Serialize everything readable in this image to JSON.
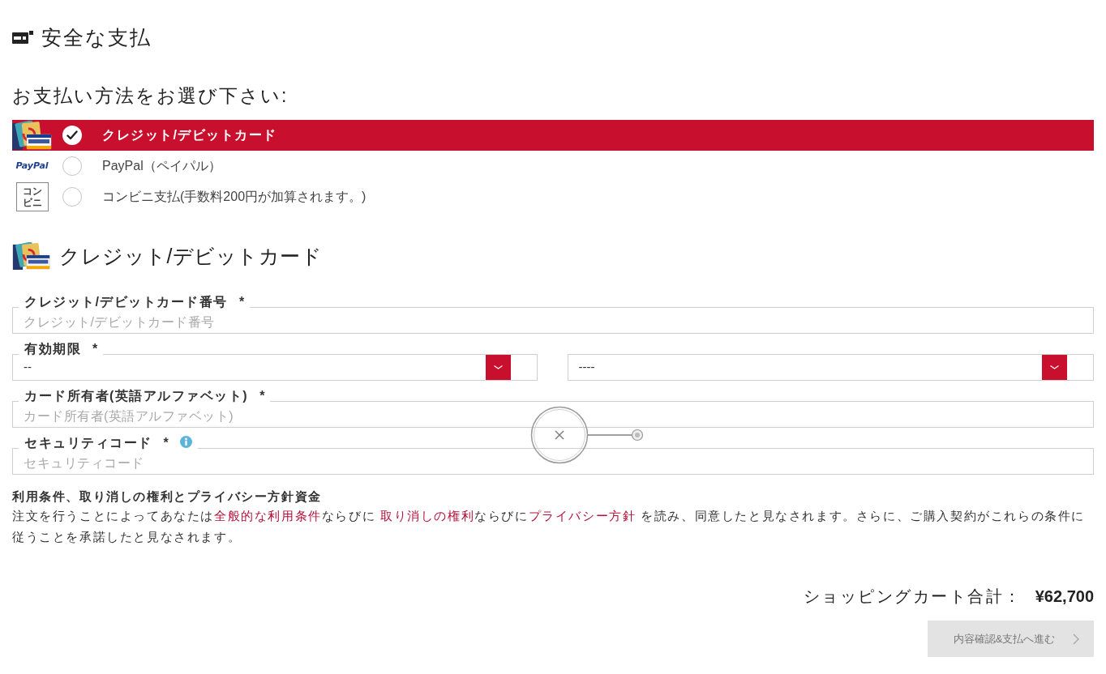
{
  "header": {
    "title": "安全な支払"
  },
  "payment": {
    "prompt": "お支払い方法をお選び下さい:",
    "methods": [
      {
        "kind": "card",
        "label": "クレジット/デビットカード",
        "selected": true
      },
      {
        "kind": "paypal",
        "logo_text": "PayPal",
        "label": "PayPal（ペイパル）",
        "selected": false
      },
      {
        "kind": "konbini",
        "logo_lines": [
          "コン",
          "ビニ"
        ],
        "label": "コンビニ支払(手数料200円が加算されます。)",
        "selected": false
      }
    ]
  },
  "card_form": {
    "title": "クレジット/デビットカード",
    "fields": [
      {
        "kind": "text",
        "label": "クレジット/デビットカード番号",
        "required_mark": "*",
        "info": false,
        "placeholder": "クレジット/デビットカード番号"
      },
      {
        "kind": "expiry",
        "label": "有効期限",
        "required_mark": "*",
        "info": false,
        "selects": [
          {
            "value": "--"
          },
          {
            "value": "----"
          }
        ]
      },
      {
        "kind": "text",
        "label": "カード所有者(英語アルファベット)",
        "required_mark": "*",
        "info": false,
        "placeholder": "カード所有者(英語アルファベット)"
      },
      {
        "kind": "text",
        "label": "セキュリティコード",
        "required_mark": "*",
        "info": true,
        "placeholder": "セキュリティコード"
      }
    ]
  },
  "terms": {
    "title": "利用条件、取り消しの権利とプライバシー方針資金",
    "segments": [
      {
        "kind": "text",
        "text": "注文を行うことによってあなたは"
      },
      {
        "kind": "link",
        "text": "全般的な利用条件"
      },
      {
        "kind": "text",
        "text": "ならびに "
      },
      {
        "kind": "link",
        "text": "取り消しの権利"
      },
      {
        "kind": "text",
        "text": "ならびに"
      },
      {
        "kind": "link",
        "text": "プライバシー方針"
      },
      {
        "kind": "text",
        "text": " を読み、同意したと見なされます。さらに、ご購入契約がこれらの条件に従うことを承諾したと見なされます。"
      }
    ]
  },
  "summary": {
    "label": "ショッピングカート合計：",
    "total": "¥62,700"
  },
  "next_button": {
    "label": "内容確認&支払へ進む",
    "disabled": true
  }
}
